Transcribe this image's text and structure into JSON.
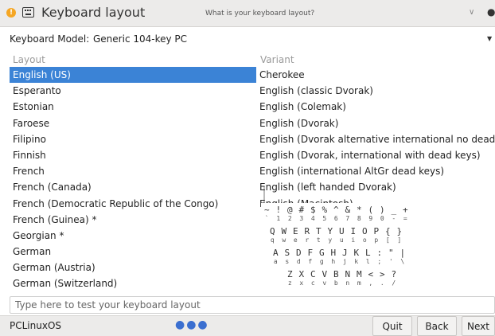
{
  "titlebar": {
    "title": "Keyboard layout",
    "question": "What is your keyboard layout?",
    "app_icon_glyph": "!",
    "app_icon": "calamares-icon",
    "keyboard_icon": "keyboard-icon",
    "minimize_glyph": "∨",
    "close_glyph": "●"
  },
  "model": {
    "label": "Keyboard Model:",
    "value": "Generic 104-key PC",
    "arrow": "▼"
  },
  "columns": {
    "layout": "Layout",
    "variant": "Variant"
  },
  "layouts": [
    "English (US)",
    "Esperanto",
    "Estonian",
    "Faroese",
    "Filipino",
    "Finnish",
    "French",
    "French (Canada)",
    "French (Democratic Republic of the Congo)",
    "French (Guinea) *",
    "Georgian *",
    "German",
    "German (Austria)",
    "German (Switzerland)"
  ],
  "selected_layout_index": 0,
  "variants": [
    "Cherokee",
    "English (classic Dvorak)",
    "English (Colemak)",
    "English (Dvorak)",
    "English (Dvorak alternative international no dead keys)",
    "English (Dvorak, international with dead keys)",
    "English (international AltGr dead keys)",
    "English (left handed Dvorak)",
    "English (Macintosh)"
  ],
  "osk": {
    "row1_upper": [
      "~",
      "!",
      "@",
      "#",
      "$",
      "%",
      "^",
      "&",
      "*",
      "(",
      ")",
      "_",
      "+"
    ],
    "row1_lower": [
      "`",
      "1",
      "2",
      "3",
      "4",
      "5",
      "6",
      "7",
      "8",
      "9",
      "0",
      "-",
      "="
    ],
    "row2_upper": [
      "Q",
      "W",
      "E",
      "R",
      "T",
      "Y",
      "U",
      "I",
      "O",
      "P",
      "{",
      "}"
    ],
    "row2_lower": [
      "q",
      "w",
      "e",
      "r",
      "t",
      "y",
      "u",
      "i",
      "o",
      "p",
      "[",
      "]"
    ],
    "row3_upper": [
      "A",
      "S",
      "D",
      "F",
      "G",
      "H",
      "J",
      "K",
      "L",
      ":",
      "\"",
      "|"
    ],
    "row3_lower": [
      "a",
      "s",
      "d",
      "f",
      "g",
      "h",
      "j",
      "k",
      "l",
      ";",
      "'",
      "\\"
    ],
    "row4_upper": [
      "Z",
      "X",
      "C",
      "V",
      "B",
      "N",
      "M",
      "<",
      ">",
      "?"
    ],
    "row4_lower": [
      "z",
      "x",
      "c",
      "v",
      "b",
      "n",
      "m",
      ",",
      ".",
      "/"
    ]
  },
  "test_input": {
    "value": "",
    "placeholder": "Type here to test your keyboard layout"
  },
  "footer": {
    "brand": "PCLinuxOS",
    "progress_dots": "●●●",
    "quit_label": "Quit",
    "back_label": "Back",
    "next_label": "Next"
  },
  "colors": {
    "selection": "#3b83d6",
    "progress": "#3b6fd0"
  }
}
